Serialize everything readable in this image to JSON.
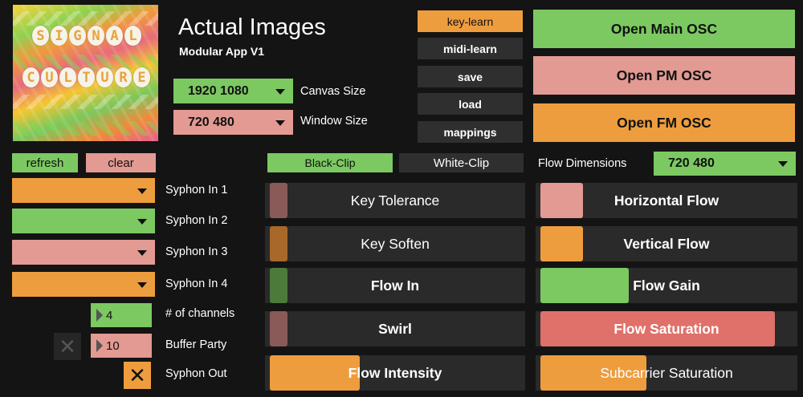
{
  "app": {
    "title": "Actual Images",
    "subtitle": "Modular App V1",
    "logo": {
      "line1": [
        "S",
        "I",
        "G",
        "N",
        "A",
        "L"
      ],
      "line2": [
        "C",
        "U",
        "L",
        "T",
        "U",
        "R",
        "E"
      ]
    }
  },
  "canvas": {
    "value": "1920 1080",
    "label": "Canvas Size"
  },
  "window": {
    "value": "720 480",
    "label": "Window Size"
  },
  "menu": [
    "key-learn",
    "midi-learn",
    "save",
    "load",
    "mappings"
  ],
  "osc": {
    "main": "Open Main OSC",
    "pm": "Open PM OSC",
    "fm": "Open FM OSC"
  },
  "syphon": {
    "refresh": "refresh",
    "clear": "clear",
    "inputs": [
      {
        "label": "Syphon In 1",
        "color": "#ee9d3e"
      },
      {
        "label": "Syphon In 2",
        "color": "#7cc962"
      },
      {
        "label": "Syphon In 3",
        "color": "#e29a93"
      },
      {
        "label": "Syphon In 4",
        "color": "#ee9d3e"
      }
    ],
    "channels": {
      "value": "4",
      "label": "# of channels"
    },
    "buffer": {
      "value": "10",
      "label": "Buffer Party"
    },
    "out": {
      "label": "Syphon Out",
      "checked": true
    },
    "aux_checked": false
  },
  "clip": {
    "black": "Black-Clip",
    "white": "White-Clip"
  },
  "flow_dimensions": {
    "label": "Flow Dimensions",
    "value": "720 480"
  },
  "sliders_left": [
    {
      "label": "Key Tolerance",
      "level": 0.07,
      "color": "#8a5a58",
      "bold": false
    },
    {
      "label": "Key Soften",
      "level": 0.07,
      "color": "#a8682a",
      "bold": false
    },
    {
      "label": "Flow In",
      "level": 0.07,
      "color": "#4c7a3a",
      "bold": true
    },
    {
      "label": "Swirl",
      "level": 0.07,
      "color": "#8a5a58",
      "bold": true
    },
    {
      "label": "Flow Intensity",
      "level": 0.36,
      "color": "#ee9d3e",
      "bold": true
    }
  ],
  "sliders_right": [
    {
      "label": "Horizontal Flow",
      "level": 0.17,
      "color": "#e29a93",
      "bold": true
    },
    {
      "label": "Vertical Flow",
      "level": 0.17,
      "color": "#ee9d3e",
      "bold": true
    },
    {
      "label": "Flow Gain",
      "level": 0.35,
      "color": "#7cc962",
      "bold": true
    },
    {
      "label": "Flow Saturation",
      "level": 0.93,
      "color": "#e0706a",
      "bold": true
    },
    {
      "label": "Subcarrier Saturation",
      "level": 0.42,
      "color": "#ee9d3e",
      "bold": false
    }
  ]
}
